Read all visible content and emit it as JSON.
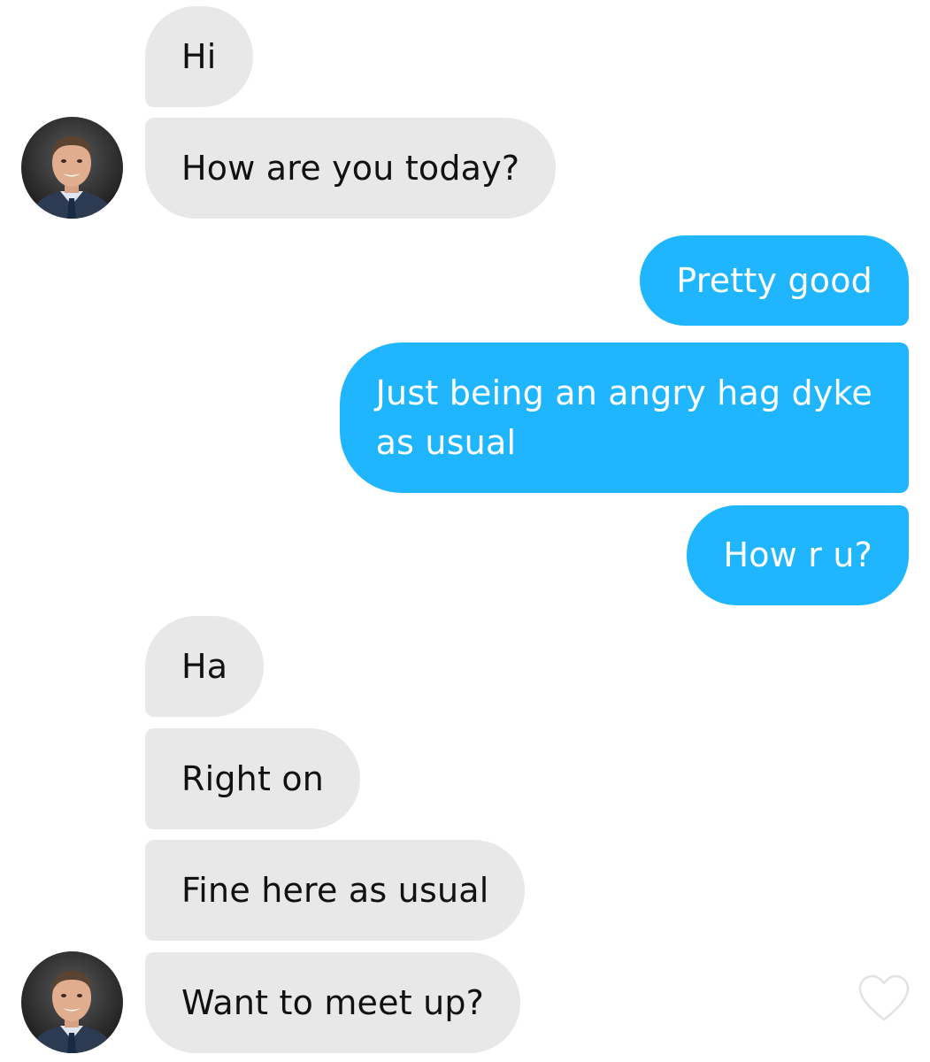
{
  "conversation": {
    "messages": [
      {
        "side": "received",
        "text": "Hi"
      },
      {
        "side": "received",
        "text": "How are you today?"
      },
      {
        "side": "sent",
        "text": "Pretty good"
      },
      {
        "side": "sent",
        "text_lines": [
          "Just being an angry hag dyke",
          "as usual"
        ]
      },
      {
        "side": "sent",
        "text": "How r u?"
      },
      {
        "side": "received",
        "text": "Ha"
      },
      {
        "side": "received",
        "text": "Right on"
      },
      {
        "side": "received",
        "text": "Fine here as usual"
      },
      {
        "side": "received",
        "text": "Want to meet up?"
      }
    ]
  },
  "colors": {
    "received_bubble": "#e8e8e8",
    "sent_bubble": "#1fb6ff",
    "received_text": "#111111",
    "sent_text": "#ffffff"
  },
  "icons": {
    "avatar": "contact-avatar-photo",
    "like": "heart-outline-icon"
  }
}
